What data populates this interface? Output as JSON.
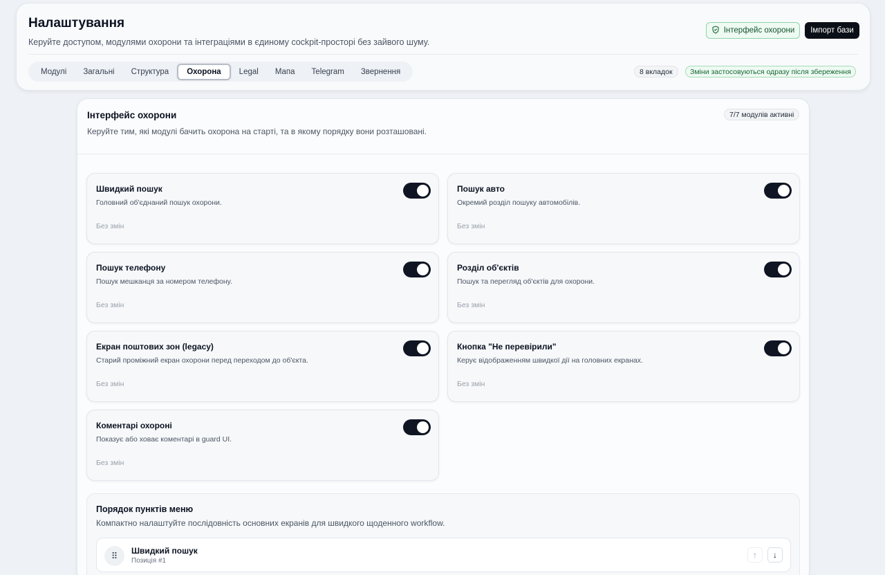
{
  "header": {
    "title": "Налаштування",
    "subtitle": "Керуйте доступом, модулями охорони та інтеграціями в єдиному cockpit-просторі без зайвого шуму.",
    "guard_button": "Інтерфейс охорони",
    "import_button": "Імпорт бази",
    "tabs_count": "8 вкладок",
    "apply_note": "Зміни застосовуються одразу після збереження"
  },
  "tabs": [
    {
      "label": "Модулі"
    },
    {
      "label": "Загальні"
    },
    {
      "label": "Структура"
    },
    {
      "label": "Охорона",
      "active": true
    },
    {
      "label": "Legal"
    },
    {
      "label": "Мапа"
    },
    {
      "label": "Telegram"
    },
    {
      "label": "Звернення"
    }
  ],
  "section": {
    "title": "Інтерфейс охорони",
    "description": "Керуйте тим, які модулі бачить охорона на старті, та в якому порядку вони розташовані.",
    "badge": "7/7 модулів активні"
  },
  "modules": [
    {
      "title": "Швидкий пошук",
      "description": "Головний об'єднаний пошук охорони.",
      "status": "Без змін",
      "enabled": true
    },
    {
      "title": "Пошук авто",
      "description": "Окремий розділ пошуку автомобілів.",
      "status": "Без змін",
      "enabled": true
    },
    {
      "title": "Пошук телефону",
      "description": "Пошук мешканця за номером телефону.",
      "status": "Без змін",
      "enabled": true
    },
    {
      "title": "Розділ об'єктів",
      "description": "Пошук та перегляд об'єктів для охорони.",
      "status": "Без змін",
      "enabled": true
    },
    {
      "title": "Екран поштових зон (legacy)",
      "description": "Старий проміжний екран охорони перед переходом до об'єкта.",
      "status": "Без змін",
      "enabled": true
    },
    {
      "title": "Кнопка \"Не перевірили\"",
      "description": "Керує відображенням швидкої дії на головних екранах.",
      "status": "Без змін",
      "enabled": true
    },
    {
      "title": "Коментарі охороні",
      "description": "Показує або ховає коментарі в guard UI.",
      "status": "Без змін",
      "enabled": true
    }
  ],
  "order": {
    "title": "Порядок пунктів меню",
    "description": "Компактно налаштуйте послідовність основних екранів для швидкого щоденного workflow.",
    "items": [
      {
        "title": "Швидкий пошук",
        "position": "Позиція #1"
      }
    ]
  },
  "icons": {
    "guard": "shield-check-icon",
    "drag": "drag-handle-icon",
    "up": "arrow-up-icon",
    "down": "arrow-down-icon"
  },
  "colors": {
    "accent_green": "#14532d",
    "toggle_on": "#0f1523",
    "background": "#eef1f5"
  }
}
